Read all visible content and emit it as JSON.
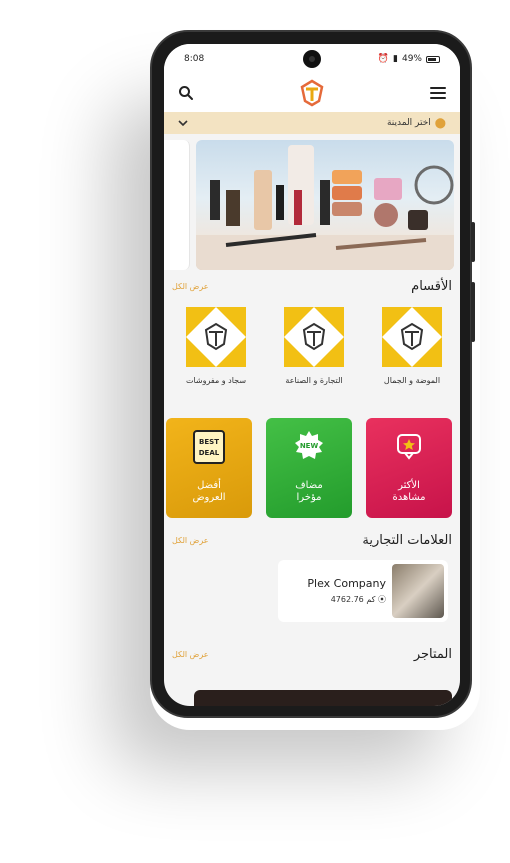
{
  "status": {
    "time": "8:08",
    "battery": "49%"
  },
  "header": {
    "logo": "app-logo",
    "search": "search-icon",
    "menu": "menu-icon"
  },
  "city": {
    "label": "اختر المدينة"
  },
  "categories_section": {
    "title": "الأقسام",
    "view_all": "عرض الكل",
    "items": [
      {
        "label": "الموضة و الجمال"
      },
      {
        "label": "التجارة و الصناعة"
      },
      {
        "label": "سجاد و مفروشات"
      }
    ]
  },
  "tiles": [
    {
      "line1": "الأكثر",
      "line2": "مشاهدة",
      "color": "#e0285a"
    },
    {
      "line1": "مضاف",
      "line2": "مؤخرا",
      "badge": "NEW",
      "color": "#36b03a"
    },
    {
      "line1": "أفضل",
      "line2": "العروض",
      "badge": "BEST DEAL",
      "color": "#e9a812"
    }
  ],
  "brands_section": {
    "title": "العلامات التجارية",
    "view_all": "عرض الكل",
    "items": [
      {
        "name": "Plex Company",
        "distance": "4762.76 كم"
      }
    ]
  },
  "stores_section": {
    "title": "المتاجر",
    "view_all": "عرض الكل"
  },
  "colors": {
    "accent": "#e0a23a",
    "city_bar": "#f3e3c2"
  }
}
